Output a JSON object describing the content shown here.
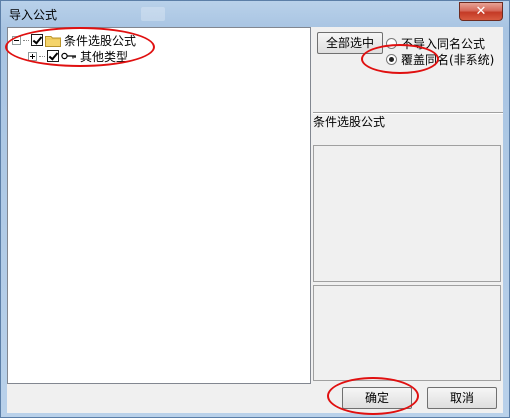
{
  "window": {
    "title": "导入公式",
    "close_glyph": "✕"
  },
  "tree": {
    "nodes": [
      {
        "label": "条件选股公式",
        "checked": true,
        "icon": "folder-icon",
        "expanded": true
      },
      {
        "label": "其他类型",
        "checked": true,
        "icon": "key-icon",
        "expanded": false
      }
    ]
  },
  "right": {
    "select_all_label": "全部选中",
    "options": [
      {
        "label": "不导入同名公式",
        "selected": false
      },
      {
        "label": "覆盖同名(非系统)",
        "selected": true
      }
    ],
    "section_label": "条件选股公式"
  },
  "buttons": {
    "ok_label": "确定",
    "cancel_label": "取消"
  },
  "colors": {
    "annotation": "#e01010"
  }
}
